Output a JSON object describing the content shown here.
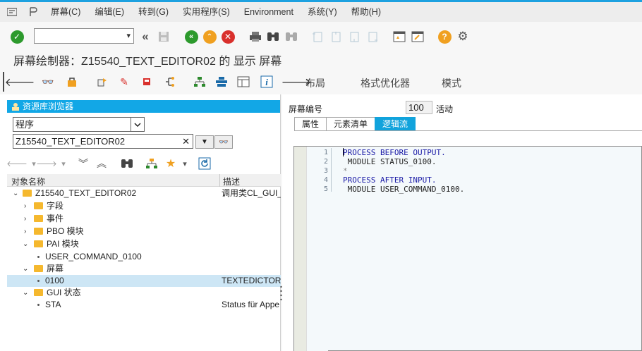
{
  "menu": {
    "items": [
      "屏幕(C)",
      "编辑(E)",
      "转到(G)",
      "实用程序(S)",
      "Environment",
      "系统(Y)",
      "帮助(H)"
    ]
  },
  "title": "屏幕绘制器：Z15540_TEXT_EDITOR02 的 显示 屏幕",
  "app_toolbar": {
    "layout": "布局",
    "format": "格式优化器",
    "mode": "模式"
  },
  "repository": {
    "header": "资源库浏览器",
    "object_type": "程序",
    "object_name": "Z15540_TEXT_EDITOR02",
    "columns": {
      "name": "对象名称",
      "description": "描述"
    },
    "tree": [
      {
        "id": "root",
        "name": "Z15540_TEXT_EDITOR02",
        "desc": "调用类CL_GUI_"
      },
      {
        "id": "fields",
        "name": "字段",
        "desc": ""
      },
      {
        "id": "events",
        "name": "事件",
        "desc": ""
      },
      {
        "id": "pbo",
        "name": "PBO 模块",
        "desc": ""
      },
      {
        "id": "pai",
        "name": "PAI 模块",
        "desc": ""
      },
      {
        "id": "pai-item",
        "name": "USER_COMMAND_0100",
        "desc": ""
      },
      {
        "id": "screens",
        "name": "屏幕",
        "desc": ""
      },
      {
        "id": "screen-item",
        "name": "0100",
        "desc": "TEXTEDICTOR"
      },
      {
        "id": "gui",
        "name": "GUI 状态",
        "desc": ""
      },
      {
        "id": "gui-item",
        "name": "STA",
        "desc": "Status für Appe"
      }
    ]
  },
  "screen": {
    "label": "屏幕编号",
    "number": "100",
    "status": "活动",
    "tabs": [
      "属性",
      "元素清单",
      "逻辑流"
    ],
    "active_tab": "逻辑流"
  },
  "editor": {
    "lines": [
      {
        "num": "1",
        "text": "PROCESS BEFORE OUTPUT.",
        "kind": "kw"
      },
      {
        "num": "2",
        "text": " MODULE STATUS_0100.",
        "kind": "text"
      },
      {
        "num": "3",
        "text": "*",
        "kind": "comment"
      },
      {
        "num": "4",
        "text": "PROCESS AFTER INPUT.",
        "kind": "kw"
      },
      {
        "num": "5",
        "text": " MODULE USER_COMMAND_0100.",
        "kind": "text"
      }
    ]
  },
  "colors": {
    "accent": "#1da1e0",
    "header_blue": "#12a7e6",
    "tab_active": "#11a3dc",
    "folder": "#f5b82e",
    "keyword": "#1a1aa6",
    "selected_row": "#cde6f5"
  },
  "icons": [
    "menu-icon",
    "toolbar-check-icon",
    "back-double-icon",
    "save-icon",
    "green-back-icon",
    "exit-icon",
    "cancel-icon",
    "print-icon",
    "find-icon",
    "find-next-icon",
    "first-page-icon",
    "prev-page-icon",
    "next-page-icon",
    "last-page-icon",
    "new-session-icon",
    "shortcut-icon",
    "help-icon",
    "settings-icon",
    "back-arrow-icon",
    "glasses-icon",
    "activate-icon",
    "where-used-icon",
    "wand-icon",
    "delete-icon",
    "branch-icon",
    "hierarchy-icon",
    "stack-icon",
    "layout-grid-icon",
    "info-icon",
    "arrow-right-icon"
  ]
}
